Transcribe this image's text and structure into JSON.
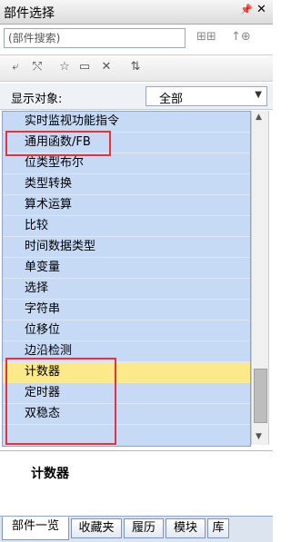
{
  "window": {
    "title": "部件选择",
    "pin": "ᵖ",
    "close": "✕"
  },
  "search": {
    "placeholder": "(部件搜索)",
    "button1": "𝖂𝖂𝖕",
    "button2": "↑⊕"
  },
  "toolbar": {
    "icons": [
      "tree-expand-icon",
      "tree-collapse-icon",
      "favorite-star-icon",
      "folder-icon",
      "delete-icon",
      "sort-icon"
    ]
  },
  "filter": {
    "label": "显示对象:",
    "selected": "全部"
  },
  "list": {
    "items": [
      {
        "label": "实时监视功能指令"
      },
      {
        "label": "通用函数/FB"
      },
      {
        "label": "位类型布尔"
      },
      {
        "label": "类型转换"
      },
      {
        "label": "算术运算"
      },
      {
        "label": "比较"
      },
      {
        "label": "时间数据类型"
      },
      {
        "label": "单变量"
      },
      {
        "label": "选择"
      },
      {
        "label": "字符串"
      },
      {
        "label": "位移位"
      },
      {
        "label": "边沿检测"
      },
      {
        "label": "计数器"
      },
      {
        "label": "定时器"
      },
      {
        "label": "双稳态"
      }
    ],
    "selected_index": 12
  },
  "description": {
    "name": "计数器"
  },
  "tabs": [
    "部件一览",
    "收藏夹",
    "履历",
    "模块",
    "库"
  ],
  "colors": {
    "list_bg": "#c6d9f5",
    "selected_bg": "#fce98a",
    "highlight_box": "#e5333b"
  }
}
